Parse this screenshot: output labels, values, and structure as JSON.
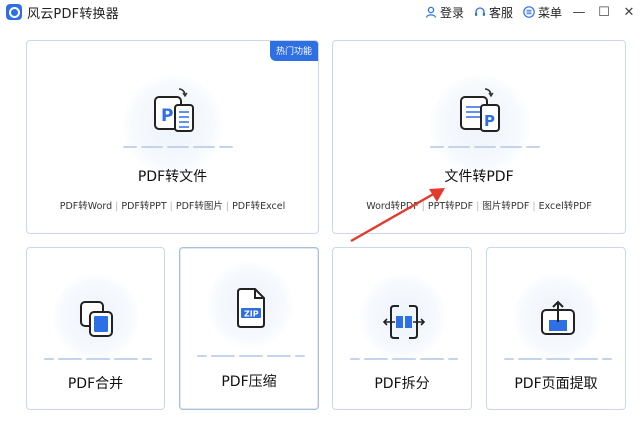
{
  "titlebar": {
    "app_title": "风云PDF转换器",
    "login_label": "登录",
    "service_label": "客服",
    "menu_label": "菜单",
    "minimize": "—",
    "maximize": "☐",
    "close": "✕"
  },
  "cards": {
    "pdf_to_file": {
      "title": "PDF转文件",
      "badge": "热门功能",
      "links": [
        "PDF转Word",
        "PDF转PPT",
        "PDF转图片",
        "PDF转Excel"
      ]
    },
    "file_to_pdf": {
      "title": "文件转PDF",
      "links": [
        "Word转PDF",
        "PPT转PDF",
        "图片转PDF",
        "Excel转PDF"
      ]
    },
    "pdf_merge": {
      "title": "PDF合并"
    },
    "pdf_compress": {
      "title": "PDF压缩",
      "zip_label": "ZIP"
    },
    "pdf_split": {
      "title": "PDF拆分"
    },
    "pdf_extract": {
      "title": "PDF页面提取"
    }
  },
  "colors": {
    "accent": "#2f6fe4",
    "card_border": "#c9d8ec",
    "arrow": "#e23b2e"
  }
}
